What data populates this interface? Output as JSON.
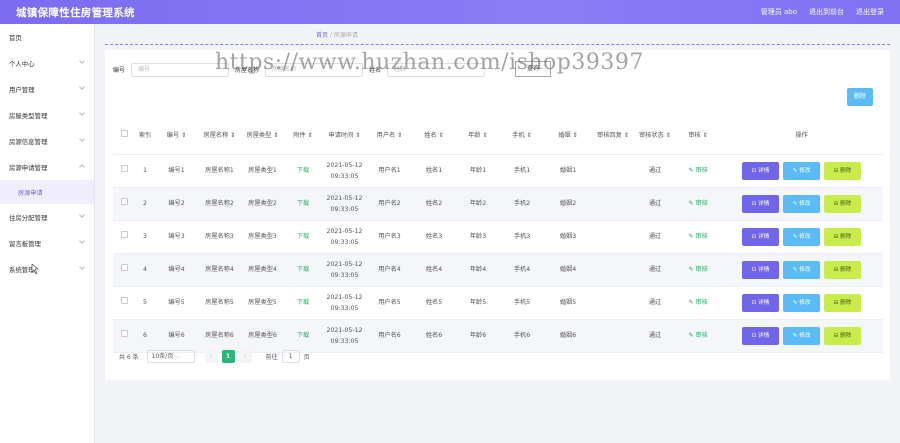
{
  "header": {
    "app_title": "城镇保障性住房管理系统",
    "links": [
      "管理员 abo",
      "退出到前台",
      "退出登录"
    ]
  },
  "sidebar": {
    "items": [
      {
        "label": "首页",
        "chevron": false
      },
      {
        "label": "个人中心",
        "chevron": true
      },
      {
        "label": "用户管理",
        "chevron": true
      },
      {
        "label": "房屋类型管理",
        "chevron": true
      },
      {
        "label": "房源信息管理",
        "chevron": true
      },
      {
        "label": "房源申请管理",
        "chevron": true
      },
      {
        "label": "住房分配管理",
        "chevron": true
      },
      {
        "label": "留言板管理",
        "chevron": true
      },
      {
        "label": "系统管理",
        "chevron": true
      }
    ],
    "active_sub": "房源申请"
  },
  "breadcrumb": {
    "home": "首页",
    "sep": "/",
    "current": "房源申请"
  },
  "search": {
    "fields": [
      {
        "label": "编号",
        "placeholder": "编号"
      },
      {
        "label": "房屋名称",
        "placeholder": "房屋名称"
      },
      {
        "label": "姓名",
        "placeholder": "姓名"
      }
    ],
    "button": "查询"
  },
  "delete_button": "删除",
  "watermark": "https://www.huzhan.com/ishop39397",
  "table": {
    "columns": [
      "索引",
      "编号 ⇕",
      "房屋名称 ⇕",
      "房屋类型 ⇕",
      "附件 ⇕",
      "申请时间 ⇕",
      "用户名 ⇕",
      "姓名 ⇕",
      "年龄 ⇕",
      "手机 ⇕",
      "婚姻 ⇕",
      "审核回复 ⇕",
      "审核状态 ⇕",
      "审核 ⇕",
      "操作"
    ],
    "rows": [
      {
        "index": "1",
        "code": "编号1",
        "name": "房屋名称1",
        "type": "房屋类型1",
        "attach": "下载",
        "time": "2021-05-12 09:33:05",
        "user": "用户名1",
        "realname": "姓名1",
        "age": "年龄1",
        "phone": "手机1",
        "marriage": "婚姻1",
        "reply": "",
        "status": "通过",
        "audit": "✎ 审核"
      },
      {
        "index": "2",
        "code": "编号2",
        "name": "房屋名称2",
        "type": "房屋类型2",
        "attach": "下载",
        "time": "2021-05-12 09:33:05",
        "user": "用户名2",
        "realname": "姓名2",
        "age": "年龄2",
        "phone": "手机2",
        "marriage": "婚姻2",
        "reply": "",
        "status": "通过",
        "audit": "✎ 审核"
      },
      {
        "index": "3",
        "code": "编号3",
        "name": "房屋名称3",
        "type": "房屋类型3",
        "attach": "下载",
        "time": "2021-05-12 09:33:05",
        "user": "用户名3",
        "realname": "姓名3",
        "age": "年龄3",
        "phone": "手机3",
        "marriage": "婚姻3",
        "reply": "",
        "status": "通过",
        "audit": "✎ 审核"
      },
      {
        "index": "4",
        "code": "编号4",
        "name": "房屋名称4",
        "type": "房屋类型4",
        "attach": "下载",
        "time": "2021-05-12 09:33:05",
        "user": "用户名4",
        "realname": "姓名4",
        "age": "年龄4",
        "phone": "手机4",
        "marriage": "婚姻4",
        "reply": "",
        "status": "通过",
        "audit": "✎ 审核"
      },
      {
        "index": "5",
        "code": "编号5",
        "name": "房屋名称5",
        "type": "房屋类型5",
        "attach": "下载",
        "time": "2021-05-12 09:33:05",
        "user": "用户名5",
        "realname": "姓名5",
        "age": "年龄5",
        "phone": "手机5",
        "marriage": "婚姻5",
        "reply": "",
        "status": "通过",
        "audit": "✎ 审核"
      },
      {
        "index": "6",
        "code": "编号6",
        "name": "房屋名称6",
        "type": "房屋类型6",
        "attach": "下载",
        "time": "2021-05-12 09:33:05",
        "user": "用户名6",
        "realname": "姓名6",
        "age": "年龄6",
        "phone": "手机6",
        "marriage": "婚姻6",
        "reply": "",
        "status": "通过",
        "audit": "✎ 审核"
      }
    ],
    "row_actions": {
      "detail": "⊡ 详情",
      "edit": "✎ 修改",
      "delete": "⊟ 删除"
    }
  },
  "pagination": {
    "total": "共 6 条",
    "page_size": "10条/页",
    "prev": "‹",
    "current": "1",
    "next": "›",
    "goto_label": "前往",
    "goto_value": "1",
    "page_unit": "页"
  },
  "colors": {
    "accent": "#7b6cf0",
    "detail": "#7266e8",
    "edit": "#5bbcf5",
    "delete": "#c9ec4d",
    "success": "#28b26a"
  }
}
